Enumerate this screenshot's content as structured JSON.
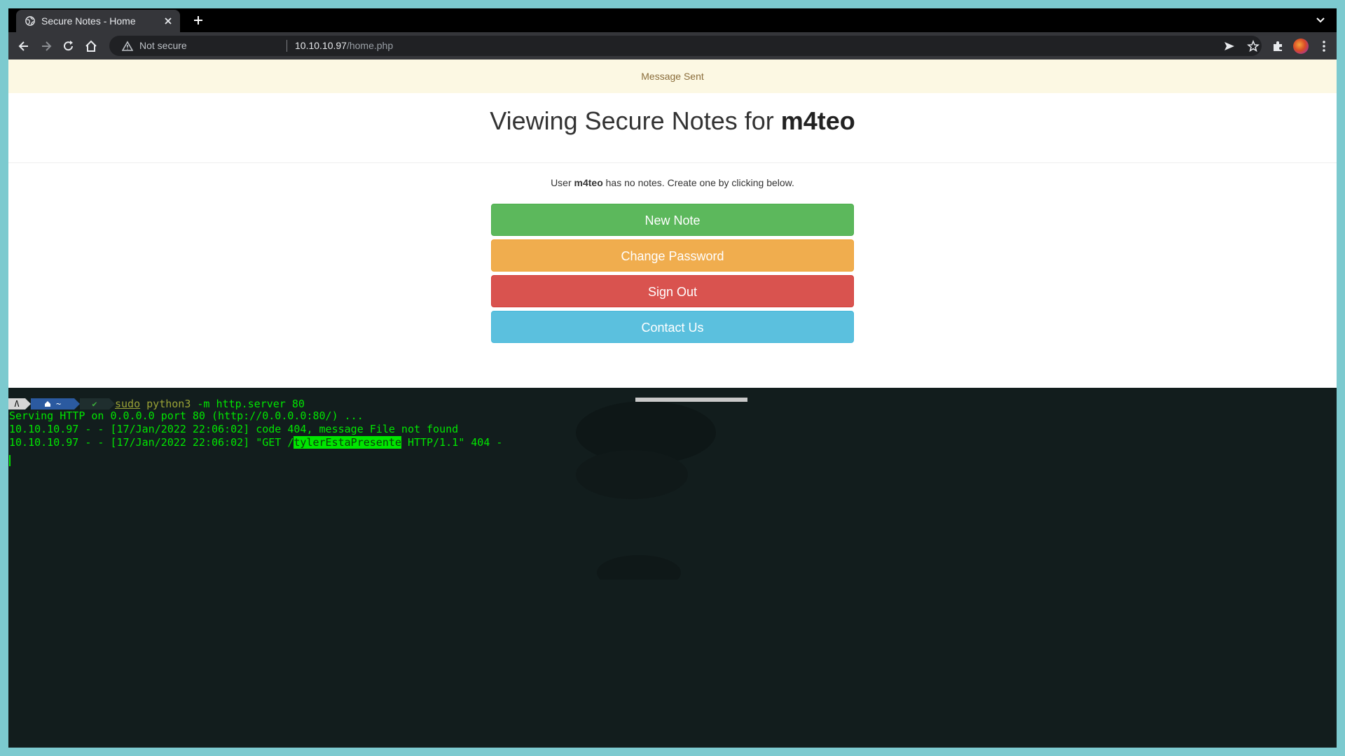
{
  "browser": {
    "tab_title": "Secure Notes - Home",
    "not_secure_label": "Not secure",
    "url_host": "10.10.10.97",
    "url_path": "/home.php"
  },
  "page": {
    "alert": "Message Sent",
    "heading_prefix": "Viewing Secure Notes for ",
    "heading_user": "m4teo",
    "notes_prefix": "User ",
    "notes_user": "m4teo",
    "notes_suffix": " has no notes. Create one by clicking below.",
    "buttons": {
      "new_note": "New Note",
      "change_password": "Change Password",
      "sign_out": "Sign Out",
      "contact_us": "Contact Us"
    },
    "colors": {
      "success": "#5cb85c",
      "warning": "#f0ad4e",
      "danger": "#d9534f",
      "info": "#5bc0de"
    }
  },
  "terminal": {
    "prompt_os": "Ʌ",
    "prompt_dir": "~",
    "prompt_status": "✔",
    "cmd_sudo": "sudo",
    "cmd_python": "python3",
    "cmd_args": "-m http.server 80",
    "lines": [
      "Serving HTTP on 0.0.0.0 port 80 (http://0.0.0.0:80/) ...",
      "10.10.10.97 - - [17/Jan/2022 22:06:02] code 404, message File not found"
    ],
    "last_line_prefix": "10.10.10.97 - - [17/Jan/2022 22:06:02] \"GET /",
    "last_line_highlight": "tylerEstaPresente",
    "last_line_suffix": " HTTP/1.1\" 404 -"
  }
}
